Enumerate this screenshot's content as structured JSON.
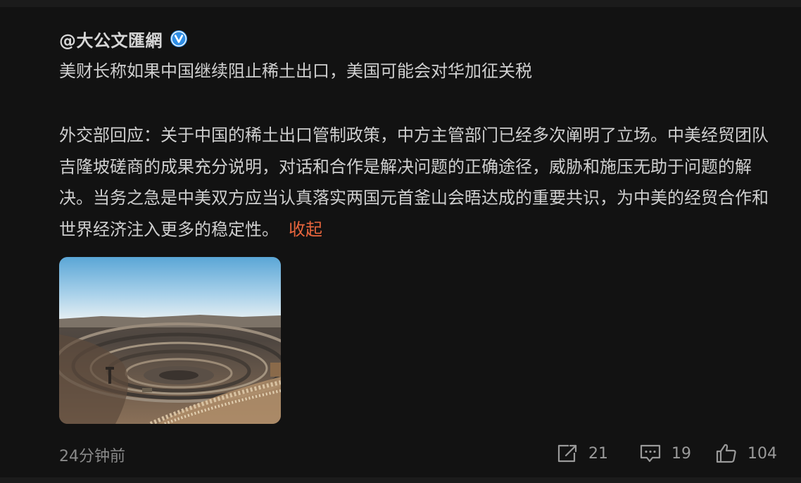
{
  "post": {
    "author": "@大公文匯網",
    "verified": true,
    "headline": "美财长称如果中国继续阻止稀土出口，美国可能会对华加征关税",
    "body": "外交部回应：关于中国的稀土出口管制政策，中方主管部门已经多次阐明了立场。中美经贸团队吉隆坡磋商的成果充分说明，对话和合作是解决问题的正确途径，威胁和施压无助于问题的解决。当务之急是中美双方应当认真落实两国元首釜山会晤达成的重要共识，为中美的经贸合作和世界经济注入更多的稳定性。",
    "collapse_label": "收起",
    "image_icon": "open-pit-mine-photo"
  },
  "footer": {
    "timestamp": "24分钟前",
    "share": {
      "icon": "share-icon",
      "count": "21"
    },
    "comment": {
      "icon": "comment-icon",
      "count": "19"
    },
    "like": {
      "icon": "thumbs-up-icon",
      "count": "104"
    }
  },
  "colors": {
    "background": "#121212",
    "text": "#cfcfcf",
    "muted": "#8a8a8a",
    "accent_link": "#e6643c",
    "verified_badge": "#2f8ee6"
  }
}
